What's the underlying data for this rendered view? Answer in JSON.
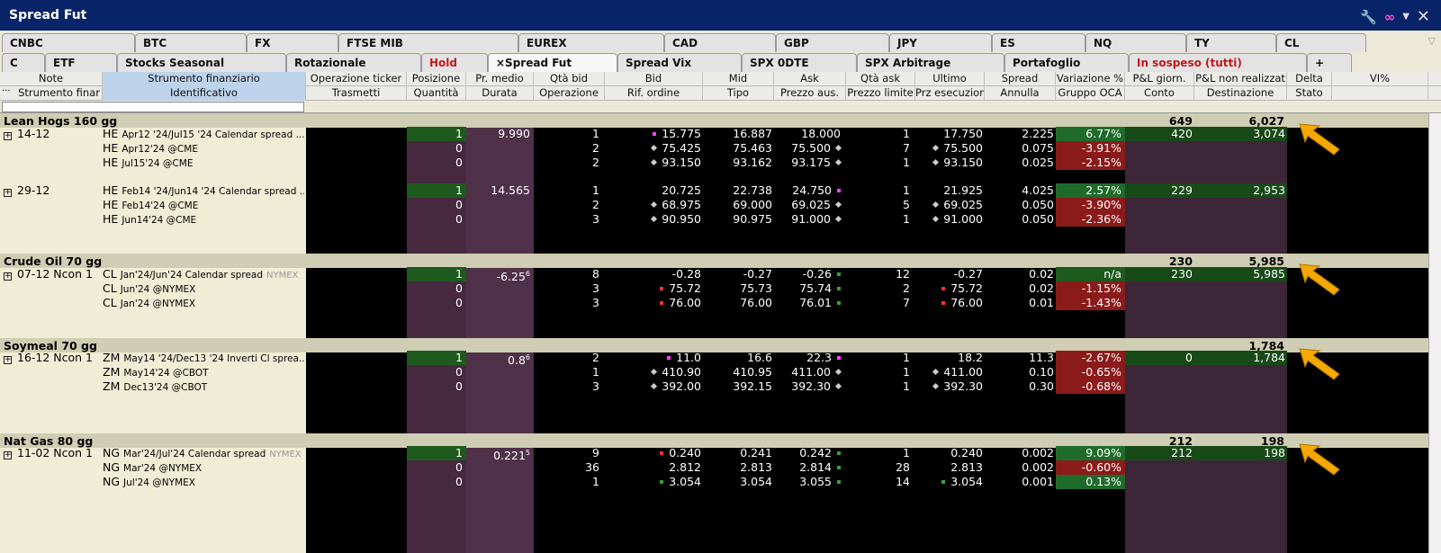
{
  "window": {
    "title": "Spread Fut"
  },
  "tabs_row1": [
    "CNBC",
    "BTC",
    "FX",
    "FTSE MIB",
    "EUREX",
    "CAD",
    "GBP",
    "JPY",
    "ES",
    "NQ",
    "TY",
    "CL"
  ],
  "tabs_row2": [
    {
      "label": "C",
      "state": "normal"
    },
    {
      "label": "ETF",
      "state": "normal"
    },
    {
      "label": "Stocks Seasonal",
      "state": "normal"
    },
    {
      "label": "Rotazionale",
      "state": "normal"
    },
    {
      "label": "Hold",
      "state": "red"
    },
    {
      "label": "×Spread Fut",
      "state": "active"
    },
    {
      "label": "Spread Vix",
      "state": "normal"
    },
    {
      "label": "SPX 0DTE",
      "state": "normal"
    },
    {
      "label": "SPX Arbitrage",
      "state": "normal"
    },
    {
      "label": "Portafoglio",
      "state": "normal"
    },
    {
      "label": "In sospeso (tutti)",
      "state": "red"
    },
    {
      "label": "+",
      "state": "normal"
    }
  ],
  "header1": [
    "Note",
    "Strumento finanziario",
    "Operazione ticker",
    "Posizione",
    "Pr. medio",
    "Qtà bid",
    "Bid",
    "Mid",
    "Ask",
    "Qtà ask",
    "Ultimo",
    "Spread",
    "Variazione %",
    "P&L giorn.",
    "P&L non realizzat",
    "Delta",
    "VI%"
  ],
  "header2": [
    "Strumento finar",
    "Identificativo",
    "Trasmetti",
    "Quantità",
    "Durata",
    "Operazione",
    "Rif. ordine",
    "Tipo",
    "Prezzo aus.",
    "Prezzo limite",
    "Prz esecuzione",
    "Annulla",
    "Gruppo OCA",
    "Conto",
    "Destinazione",
    "Stato",
    ""
  ],
  "header_extra": "···",
  "groups": [
    {
      "name": "Lean Hogs 160 gg",
      "pnl_day": "649",
      "pnl_unreal": "6,027"
    },
    {
      "name": "Crude Oil 70 gg",
      "pnl_day": "230",
      "pnl_unreal": "5,985"
    },
    {
      "name": "Soymeal 70 gg",
      "pnl_day": "",
      "pnl_unreal": "1,784"
    },
    {
      "name": "Nat Gas 80 gg",
      "pnl_day": "212",
      "pnl_unreal": "198"
    }
  ],
  "rows": [
    {
      "note": "14-12",
      "sym": "HE",
      "desc": "Apr12 '24/Jul15 '24 Calendar spread ...",
      "exch": "",
      "pos": "1",
      "avg": "9.990",
      "qb": "1",
      "bid": "15.775",
      "mid": "16.887",
      "ask": "18.000",
      "qa": "1",
      "last": "17.750",
      "spread": "2.225",
      "chg": "6.77%",
      "pnld": "420",
      "pnlu": "3,074"
    },
    {
      "note": "",
      "sym": "HE",
      "desc": "Apr12'24 @CME",
      "exch": "",
      "pos": "0",
      "avg": "",
      "qb": "2",
      "bid": "75.425",
      "mid": "75.463",
      "ask": "75.500",
      "qa": "7",
      "last": "75.500",
      "spread": "0.075",
      "chg": "-3.91%",
      "pnld": "",
      "pnlu": ""
    },
    {
      "note": "",
      "sym": "HE",
      "desc": "Jul15'24 @CME",
      "exch": "",
      "pos": "0",
      "avg": "",
      "qb": "2",
      "bid": "93.150",
      "mid": "93.162",
      "ask": "93.175",
      "qa": "1",
      "last": "93.150",
      "spread": "0.025",
      "chg": "-2.15%",
      "pnld": "",
      "pnlu": ""
    },
    {
      "note": "29-12",
      "sym": "HE",
      "desc": "Feb14 '24/Jun14 '24 Calendar spread ...",
      "exch": "",
      "pos": "1",
      "avg": "14.565",
      "qb": "1",
      "bid": "20.725",
      "mid": "22.738",
      "ask": "24.750",
      "qa": "1",
      "last": "21.925",
      "spread": "4.025",
      "chg": "2.57%",
      "pnld": "229",
      "pnlu": "2,953"
    },
    {
      "note": "",
      "sym": "HE",
      "desc": "Feb14'24 @CME",
      "exch": "",
      "pos": "0",
      "avg": "",
      "qb": "2",
      "bid": "68.975",
      "mid": "69.000",
      "ask": "69.025",
      "qa": "5",
      "last": "69.025",
      "spread": "0.050",
      "chg": "-3.90%",
      "pnld": "",
      "pnlu": ""
    },
    {
      "note": "",
      "sym": "HE",
      "desc": "Jun14'24 @CME",
      "exch": "",
      "pos": "0",
      "avg": "",
      "qb": "3",
      "bid": "90.950",
      "mid": "90.975",
      "ask": "91.000",
      "qa": "1",
      "last": "91.000",
      "spread": "0.050",
      "chg": "-2.36%",
      "pnld": "",
      "pnlu": ""
    },
    {
      "note": "07-12 Ncon 1",
      "sym": "CL",
      "desc": "Jan'24/Jun'24 Calendar spread",
      "exch": "NYMEX",
      "pos": "1",
      "avg": "-6.25",
      "avgsup": "6",
      "qb": "8",
      "bid": "-0.28",
      "mid": "-0.27",
      "ask": "-0.26",
      "qa": "12",
      "last": "-0.27",
      "spread": "0.02",
      "chg": "n/a",
      "pnld": "230",
      "pnlu": "5,985"
    },
    {
      "note": "",
      "sym": "CL",
      "desc": "Jun'24 @NYMEX",
      "exch": "",
      "pos": "0",
      "avg": "",
      "qb": "3",
      "bid": "75.72",
      "mid": "75.73",
      "ask": "75.74",
      "qa": "2",
      "last": "75.72",
      "spread": "0.02",
      "chg": "-1.15%",
      "pnld": "",
      "pnlu": ""
    },
    {
      "note": "",
      "sym": "CL",
      "desc": "Jan'24 @NYMEX",
      "exch": "",
      "pos": "0",
      "avg": "",
      "qb": "3",
      "bid": "76.00",
      "mid": "76.00",
      "ask": "76.01",
      "qa": "7",
      "last": "76.00",
      "spread": "0.01",
      "chg": "-1.43%",
      "pnld": "",
      "pnlu": ""
    },
    {
      "note": "16-12 Ncon 1",
      "sym": "ZM",
      "desc": "May14 '24/Dec13 '24 Inverti Cl sprea...",
      "exch": "",
      "pos": "1",
      "avg": "0.8",
      "avgsup": "6",
      "qb": "2",
      "bid": "11.0",
      "mid": "16.6",
      "ask": "22.3",
      "qa": "1",
      "last": "18.2",
      "spread": "11.3",
      "chg": "-2.67%",
      "pnld": "0",
      "pnlu": "1,784"
    },
    {
      "note": "",
      "sym": "ZM",
      "desc": "May14'24 @CBOT",
      "exch": "",
      "pos": "0",
      "avg": "",
      "qb": "1",
      "bid": "410.90",
      "mid": "410.95",
      "ask": "411.00",
      "qa": "1",
      "last": "411.00",
      "spread": "0.10",
      "chg": "-0.65%",
      "pnld": "",
      "pnlu": ""
    },
    {
      "note": "",
      "sym": "ZM",
      "desc": "Dec13'24 @CBOT",
      "exch": "",
      "pos": "0",
      "avg": "",
      "qb": "3",
      "bid": "392.00",
      "mid": "392.15",
      "ask": "392.30",
      "qa": "1",
      "last": "392.30",
      "spread": "0.30",
      "chg": "-0.68%",
      "pnld": "",
      "pnlu": ""
    },
    {
      "note": "11-02 Ncon 1",
      "sym": "NG",
      "desc": "Mar'24/Jul'24 Calendar spread",
      "exch": "NYMEX",
      "pos": "1",
      "avg": "0.221",
      "avgsup": "5",
      "qb": "9",
      "bid": "0.240",
      "mid": "0.241",
      "ask": "0.242",
      "qa": "1",
      "last": "0.240",
      "spread": "0.002",
      "chg": "9.09%",
      "pnld": "212",
      "pnlu": "198"
    },
    {
      "note": "",
      "sym": "NG",
      "desc": "Mar'24 @NYMEX",
      "exch": "",
      "pos": "0",
      "avg": "",
      "qb": "36",
      "bid": "2.812",
      "mid": "2.813",
      "ask": "2.814",
      "qa": "28",
      "last": "2.813",
      "spread": "0.002",
      "chg": "-0.60%",
      "pnld": "",
      "pnlu": ""
    },
    {
      "note": "",
      "sym": "NG",
      "desc": "Jul'24 @NYMEX",
      "exch": "",
      "pos": "0",
      "avg": "",
      "qb": "1",
      "bid": "3.054",
      "mid": "3.054",
      "ask": "3.055",
      "qa": "14",
      "last": "3.054",
      "spread": "0.001",
      "chg": "0.13%",
      "pnld": "",
      "pnlu": ""
    }
  ],
  "colors": {
    "title_bar": "#0a246a",
    "group_band": "#cfcdb3",
    "note_col": "#efedd5",
    "pos_col": "#4a2c44",
    "chg_red": "#8b1b1b",
    "chg_green": "#1f6b2a",
    "arrow": "#f5a800"
  },
  "icons": [
    "wrench-icon",
    "link-icon",
    "dropdown-icon",
    "close-icon",
    "filter-icon",
    "expand-icon",
    "arrow-icon"
  ]
}
